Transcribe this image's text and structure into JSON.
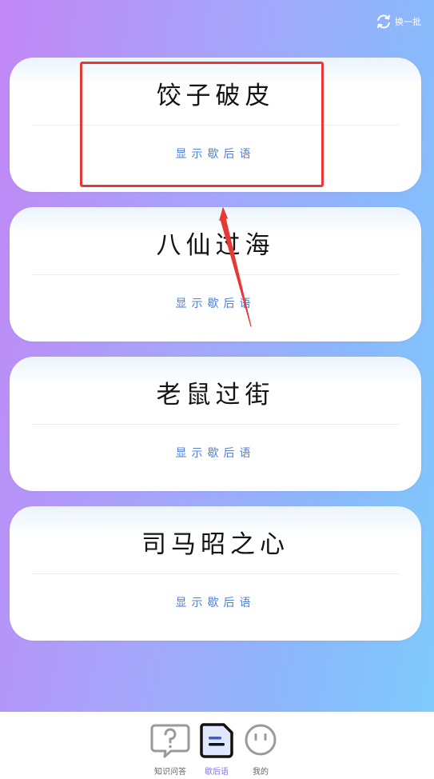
{
  "header": {
    "refresh_label": "换一批",
    "refresh_icon": "refresh-icon"
  },
  "cards": [
    {
      "idiom": "饺子破皮",
      "action": "显示歇后语"
    },
    {
      "idiom": "八仙过海",
      "action": "显示歇后语"
    },
    {
      "idiom": "老鼠过街",
      "action": "显示歇后语"
    },
    {
      "idiom": "司马昭之心",
      "action": "显示歇后语"
    }
  ],
  "tabs": [
    {
      "label": "知识问答",
      "icon": "question-chat-icon"
    },
    {
      "label": "歇后语",
      "icon": "document-icon",
      "active": true
    },
    {
      "label": "我的",
      "icon": "face-icon"
    }
  ],
  "colors": {
    "gradient_start": "#c287f5",
    "gradient_end": "#7fcbfd",
    "action_text": "#4f7fd9",
    "highlight": "#e53935",
    "active_tab": "#8b6ff0"
  }
}
